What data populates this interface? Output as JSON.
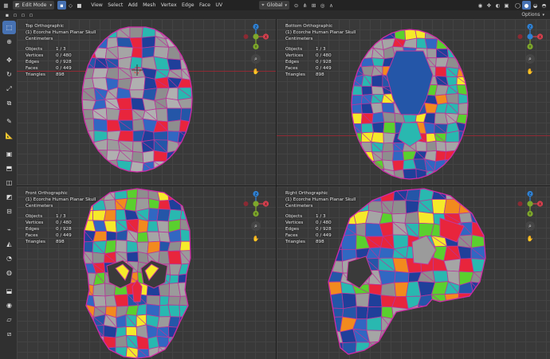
{
  "header": {
    "mode": "Edit Mode",
    "menus": [
      "View",
      "Select",
      "Add",
      "Mesh",
      "Vertex",
      "Edge",
      "Face",
      "UV"
    ],
    "transform_orientation": "Global",
    "options_label": "Options"
  },
  "colors": {
    "accent": "#4772b3",
    "header_bg": "#232323",
    "viewport_bg": "#393939",
    "wire": "#c5369c",
    "x_axis": "#d6404e",
    "y_axis": "#7ea82b",
    "z_axis": "#2f82d6"
  },
  "toolbar_icons": [
    "select-box-icon",
    "cursor-icon",
    "move-icon",
    "rotate-icon",
    "scale-icon",
    "transform-icon",
    "annotate-icon",
    "measure-icon",
    "add-cube-icon",
    "extrude-icon",
    "inset-icon",
    "bevel-icon",
    "loop-cut-icon",
    "knife-icon",
    "poly-build-icon",
    "spin-icon",
    "smooth-icon",
    "edge-slide-icon",
    "shrink-icon",
    "shear-icon",
    "rip-icon"
  ],
  "viewports": [
    {
      "view": "Top Orthographic",
      "object": "(1) Ecorche Human Planar Skull",
      "units": "Centimeters",
      "stats": [
        {
          "label": "Objects",
          "value": "1 / 3"
        },
        {
          "label": "Vertices",
          "value": "0 / 480"
        },
        {
          "label": "Edges",
          "value": "0 / 928"
        },
        {
          "label": "Faces",
          "value": "0 / 449"
        },
        {
          "label": "Triangles",
          "value": "898"
        }
      ]
    },
    {
      "view": "Bottom Orthographic",
      "object": "(1) Ecorche Human Planar Skull",
      "units": "Centimeters",
      "stats": [
        {
          "label": "Objects",
          "value": "1 / 3"
        },
        {
          "label": "Vertices",
          "value": "0 / 480"
        },
        {
          "label": "Edges",
          "value": "0 / 928"
        },
        {
          "label": "Faces",
          "value": "0 / 449"
        },
        {
          "label": "Triangles",
          "value": "898"
        }
      ]
    },
    {
      "view": "Front Orthographic",
      "object": "(1) Ecorche Human Planar Skull",
      "units": "Centimeters",
      "stats": [
        {
          "label": "Objects",
          "value": "1 / 3"
        },
        {
          "label": "Vertices",
          "value": "0 / 480"
        },
        {
          "label": "Edges",
          "value": "0 / 928"
        },
        {
          "label": "Faces",
          "value": "0 / 449"
        },
        {
          "label": "Triangles",
          "value": "898"
        }
      ]
    },
    {
      "view": "Right Orthographic",
      "object": "(1) Ecorche Human Planar Skull",
      "units": "Centimeters",
      "stats": [
        {
          "label": "Objects",
          "value": "1 / 3"
        },
        {
          "label": "Vertices",
          "value": "0 / 480"
        },
        {
          "label": "Edges",
          "value": "0 / 928"
        },
        {
          "label": "Faces",
          "value": "0 / 449"
        },
        {
          "label": "Triangles",
          "value": "898"
        }
      ]
    }
  ],
  "gizmo_labels": {
    "x": "X",
    "y": "Y",
    "z": "Z"
  }
}
